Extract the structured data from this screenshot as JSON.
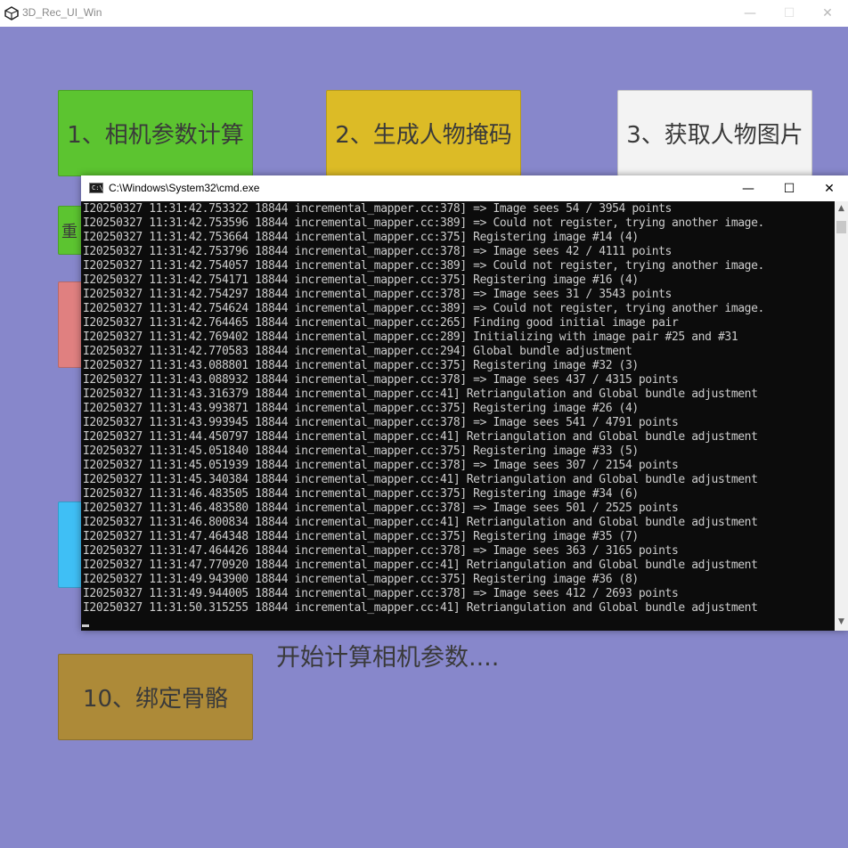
{
  "app": {
    "title": "3D_Rec_UI_Win",
    "controls": {
      "minimize": "—",
      "maximize": "☐",
      "close": "✕"
    }
  },
  "tiles": [
    {
      "label": "1、相机参数计算",
      "color": "#5cc430"
    },
    {
      "label": "2、生成人物掩码",
      "color": "#dcbb26"
    },
    {
      "label": "3、获取人物图片",
      "color": "#f3f3f3"
    },
    {
      "label": "重",
      "color": "#5cc430"
    },
    {
      "label": "",
      "color": "#e08080"
    },
    {
      "label": "",
      "color": "#3fbff5"
    },
    {
      "label": "10、绑定骨骼",
      "color": "#ad8a38"
    }
  ],
  "status": {
    "text": "开始计算相机参数...."
  },
  "cmd": {
    "title": "C:\\Windows\\System32\\cmd.exe",
    "icon_label": "C:\\",
    "controls": {
      "minimize": "—",
      "maximize": "☐",
      "close": "✕"
    },
    "lines": [
      "I20250327 11:31:42.753322 18844 incremental_mapper.cc:378] => Image sees 54 / 3954 points",
      "I20250327 11:31:42.753596 18844 incremental_mapper.cc:389] => Could not register, trying another image.",
      "I20250327 11:31:42.753664 18844 incremental_mapper.cc:375] Registering image #14 (4)",
      "I20250327 11:31:42.753796 18844 incremental_mapper.cc:378] => Image sees 42 / 4111 points",
      "I20250327 11:31:42.754057 18844 incremental_mapper.cc:389] => Could not register, trying another image.",
      "I20250327 11:31:42.754171 18844 incremental_mapper.cc:375] Registering image #16 (4)",
      "I20250327 11:31:42.754297 18844 incremental_mapper.cc:378] => Image sees 31 / 3543 points",
      "I20250327 11:31:42.754624 18844 incremental_mapper.cc:389] => Could not register, trying another image.",
      "I20250327 11:31:42.764465 18844 incremental_mapper.cc:265] Finding good initial image pair",
      "I20250327 11:31:42.769402 18844 incremental_mapper.cc:289] Initializing with image pair #25 and #31",
      "I20250327 11:31:42.770583 18844 incremental_mapper.cc:294] Global bundle adjustment",
      "I20250327 11:31:43.088801 18844 incremental_mapper.cc:375] Registering image #32 (3)",
      "I20250327 11:31:43.088932 18844 incremental_mapper.cc:378] => Image sees 437 / 4315 points",
      "I20250327 11:31:43.316379 18844 incremental_mapper.cc:41] Retriangulation and Global bundle adjustment",
      "I20250327 11:31:43.993871 18844 incremental_mapper.cc:375] Registering image #26 (4)",
      "I20250327 11:31:43.993945 18844 incremental_mapper.cc:378] => Image sees 541 / 4791 points",
      "I20250327 11:31:44.450797 18844 incremental_mapper.cc:41] Retriangulation and Global bundle adjustment",
      "I20250327 11:31:45.051840 18844 incremental_mapper.cc:375] Registering image #33 (5)",
      "I20250327 11:31:45.051939 18844 incremental_mapper.cc:378] => Image sees 307 / 2154 points",
      "I20250327 11:31:45.340384 18844 incremental_mapper.cc:41] Retriangulation and Global bundle adjustment",
      "I20250327 11:31:46.483505 18844 incremental_mapper.cc:375] Registering image #34 (6)",
      "I20250327 11:31:46.483580 18844 incremental_mapper.cc:378] => Image sees 501 / 2525 points",
      "I20250327 11:31:46.800834 18844 incremental_mapper.cc:41] Retriangulation and Global bundle adjustment",
      "I20250327 11:31:47.464348 18844 incremental_mapper.cc:375] Registering image #35 (7)",
      "I20250327 11:31:47.464426 18844 incremental_mapper.cc:378] => Image sees 363 / 3165 points",
      "I20250327 11:31:47.770920 18844 incremental_mapper.cc:41] Retriangulation and Global bundle adjustment",
      "I20250327 11:31:49.943900 18844 incremental_mapper.cc:375] Registering image #36 (8)",
      "I20250327 11:31:49.944005 18844 incremental_mapper.cc:378] => Image sees 412 / 2693 points",
      "I20250327 11:31:50.315255 18844 incremental_mapper.cc:41] Retriangulation and Global bundle adjustment"
    ]
  }
}
